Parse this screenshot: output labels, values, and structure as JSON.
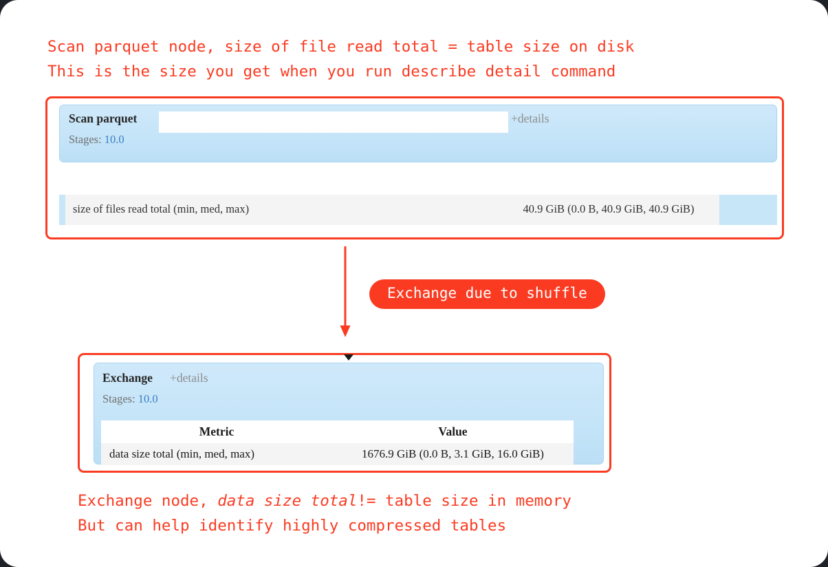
{
  "colors": {
    "accent_red": "#fa3b22",
    "node_blue": "#c4e4f8",
    "metric_row_gray": "#f4f4f4",
    "stage_link_blue": "#3a7fc1",
    "details_gray": "#8d8d8d",
    "page_background": "#ffffff"
  },
  "annotations": {
    "top_caption_line1": "Scan parquet node, size of file read total = table size on disk",
    "top_caption_line2": "This is the size you get when you run describe detail command",
    "bottom_caption_line1_part1": "Exchange node, ",
    "bottom_caption_line1_emphasis": "data size total",
    "bottom_caption_line1_part2": "!= table size in memory",
    "bottom_caption_line2": "But can help identify highly compressed tables",
    "shuffle_badge": "Exchange due to shuffle"
  },
  "scan_panel": {
    "node_title": "Scan parquet",
    "details_link": "+details",
    "stages_label": "Stages:",
    "stages_value": "10.0",
    "metric": {
      "label": "size of files read total (min, med, max)",
      "value": "40.9 GiB (0.0 B, 40.9 GiB, 40.9 GiB)"
    }
  },
  "exchange_panel": {
    "node_title": "Exchange",
    "details_link": "+details",
    "stages_label": "Stages:",
    "stages_value": "10.0",
    "table": {
      "headers": [
        "Metric",
        "Value"
      ],
      "rows": [
        {
          "metric": "data size total (min, med, max)",
          "value": "1676.9 GiB (0.0 B, 3.1 GiB, 16.0 GiB)"
        }
      ]
    }
  }
}
